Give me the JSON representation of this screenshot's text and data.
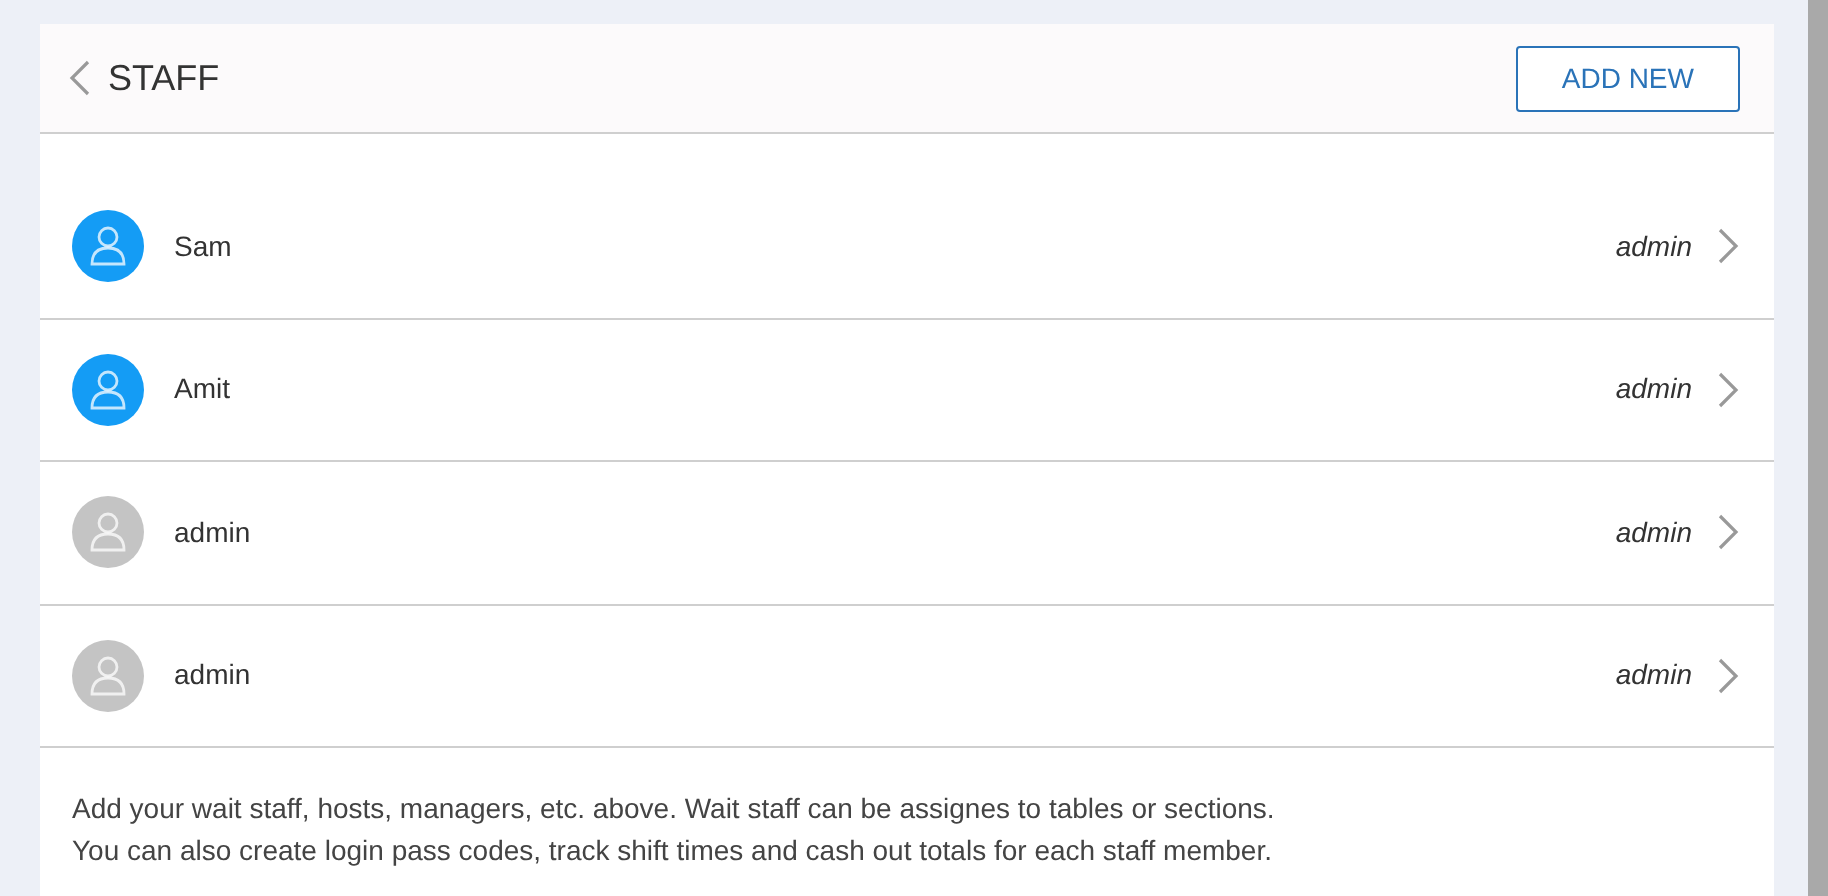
{
  "header": {
    "title": "STAFF",
    "add_button": "ADD NEW"
  },
  "staff": [
    {
      "name": "Sam",
      "role": "admin",
      "color": "#149cf5"
    },
    {
      "name": "Amit",
      "role": "admin",
      "color": "#149cf5"
    },
    {
      "name": "admin",
      "role": "admin",
      "color": "#c4c4c4"
    },
    {
      "name": "admin",
      "role": "admin",
      "color": "#c4c4c4"
    }
  ],
  "description": [
    "Add your wait staff, hosts, managers, etc. above. Wait staff can be assignes to tables or sections.",
    "You can also create login pass codes, track shift times and cash out totals for each staff member."
  ]
}
